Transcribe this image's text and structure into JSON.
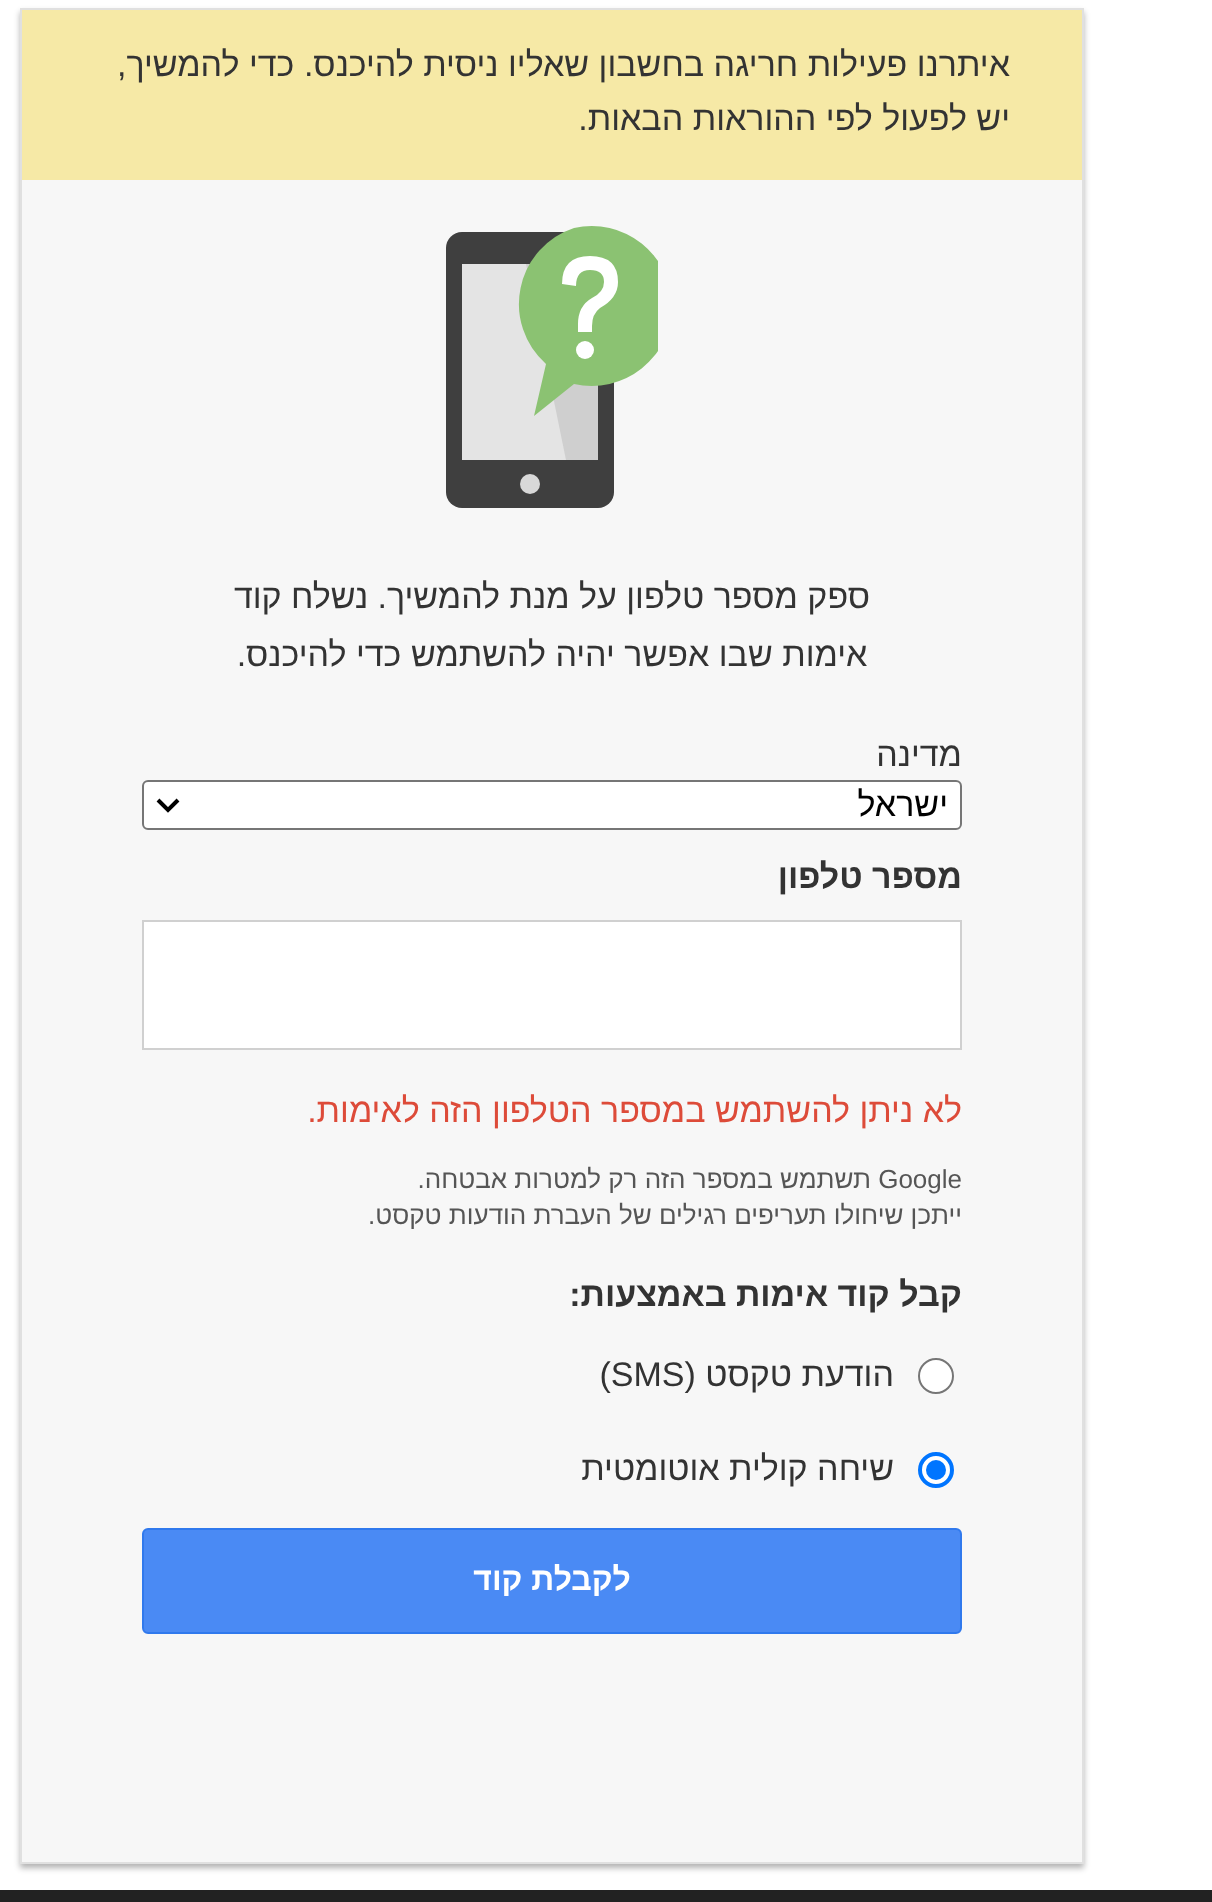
{
  "banner": {
    "text": "איתרנו פעילות חריגה בחשבון שאליו ניסית להיכנס. כדי להמשיך,  יש לפעול לפי ההוראות הבאות."
  },
  "description": "ספק מספר טלפון על מנת להמשיך. נשלח קוד אימות שבו אפשר יהיה להשתמש כדי להיכנס.",
  "country": {
    "label": "מדינה",
    "value": "ישראל"
  },
  "phone": {
    "label": "מספר טלפון"
  },
  "error": "לא ניתן להשתמש במספר הטלפון הזה לאימות.",
  "notes": [
    "Google תשתמש במספר הזה רק למטרות אבטחה.",
    "ייתכן שיחולו תעריפים רגילים של העברת הודעות טקסט."
  ],
  "method_heading": "קבל קוד אימות באמצעות:",
  "methods": [
    {
      "label": "הודעת טקסט (SMS)",
      "selected": false
    },
    {
      "label": "שיחה קולית אוטומטית",
      "selected": true
    }
  ],
  "submit": "לקבלת קוד"
}
